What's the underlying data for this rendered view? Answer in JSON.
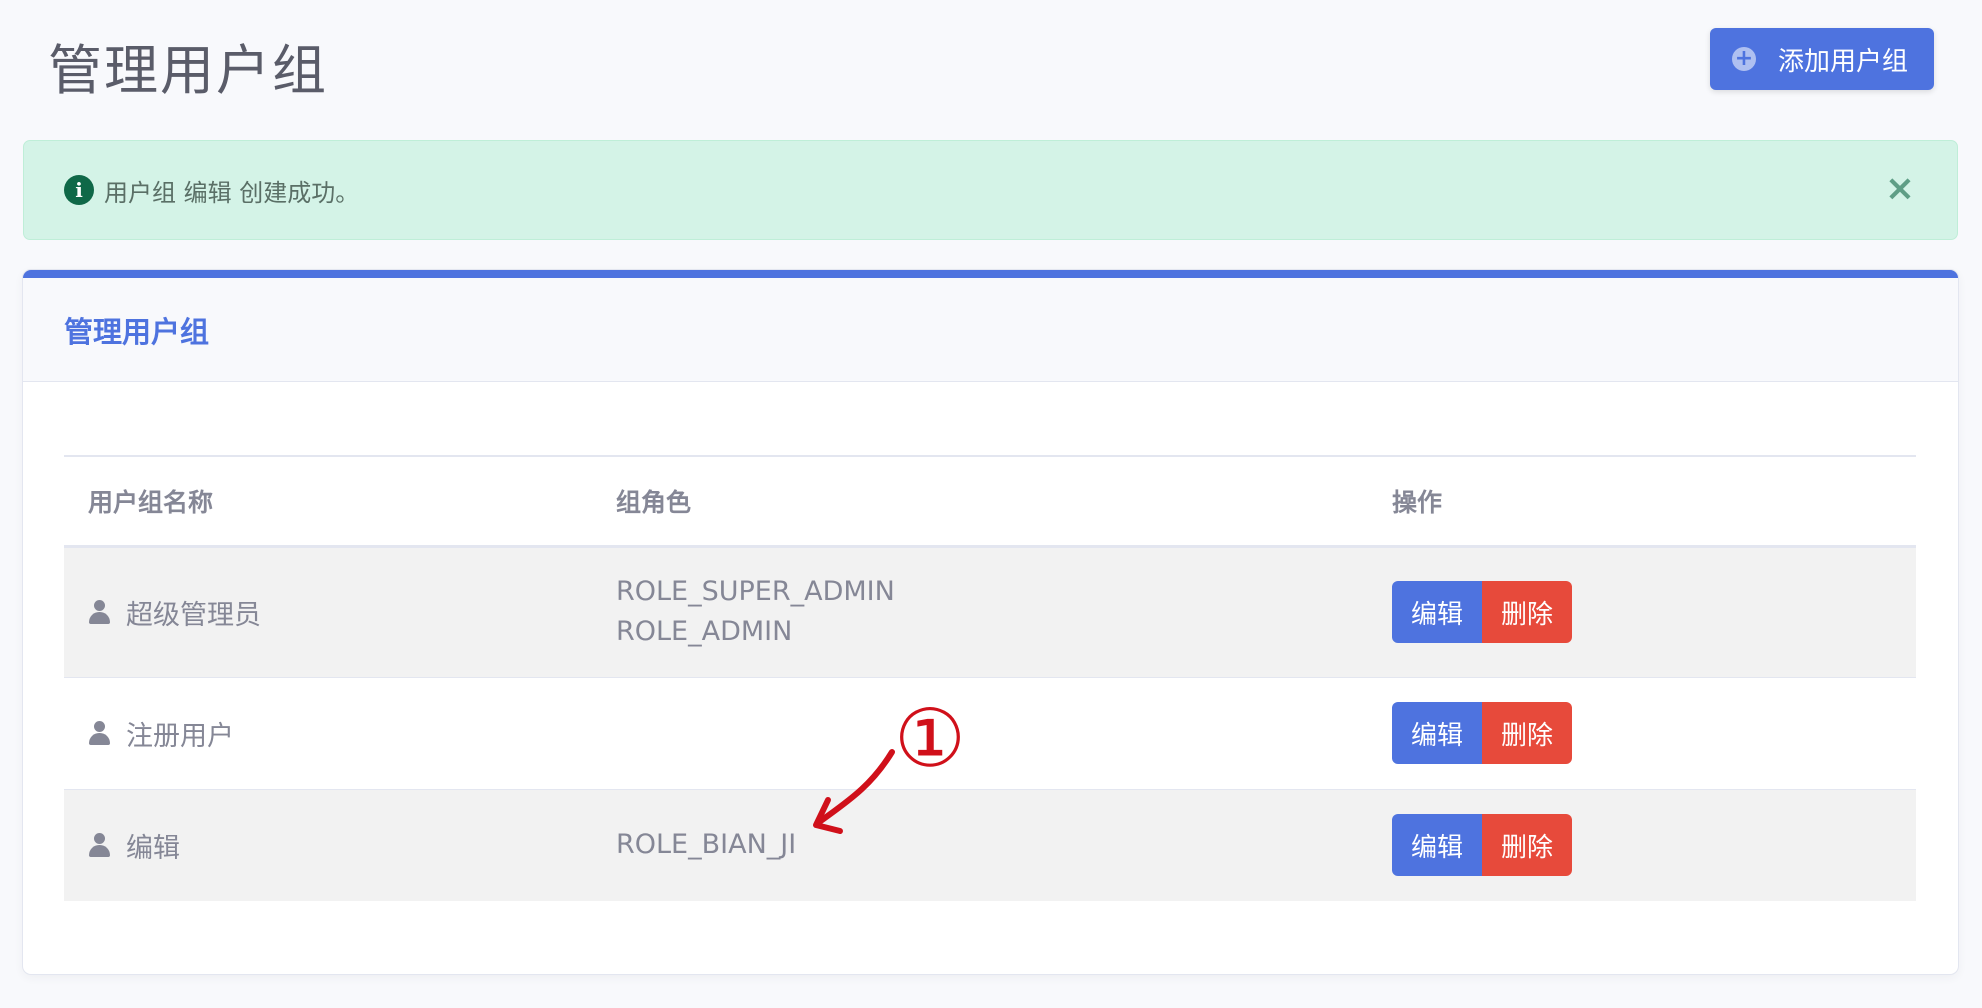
{
  "header": {
    "title": "管理用户组",
    "add_button_label": "添加用户组",
    "add_button_icon": "plus-circle-icon"
  },
  "alert": {
    "message": "用户组 编辑 创建成功。",
    "icon": "info-circle-icon",
    "close_symbol": "×",
    "color": "#d4f3e7"
  },
  "card": {
    "title": "管理用户组",
    "accent_color": "#4e73df"
  },
  "table": {
    "columns": [
      "用户组名称",
      "组角色",
      "操作"
    ],
    "rows": [
      {
        "name": "超级管理员",
        "roles": [
          "ROLE_SUPER_ADMIN",
          "ROLE_ADMIN"
        ],
        "edit_label": "编辑",
        "delete_label": "删除"
      },
      {
        "name": "注册用户",
        "roles": [],
        "edit_label": "编辑",
        "delete_label": "删除"
      },
      {
        "name": "编辑",
        "roles": [
          "ROLE_BIAN_JI"
        ],
        "edit_label": "编辑",
        "delete_label": "删除"
      }
    ]
  },
  "annotation": {
    "label": "①",
    "color": "#d0101a"
  },
  "colors": {
    "primary": "#4e73df",
    "danger": "#e74a3b",
    "text": "#858796"
  }
}
